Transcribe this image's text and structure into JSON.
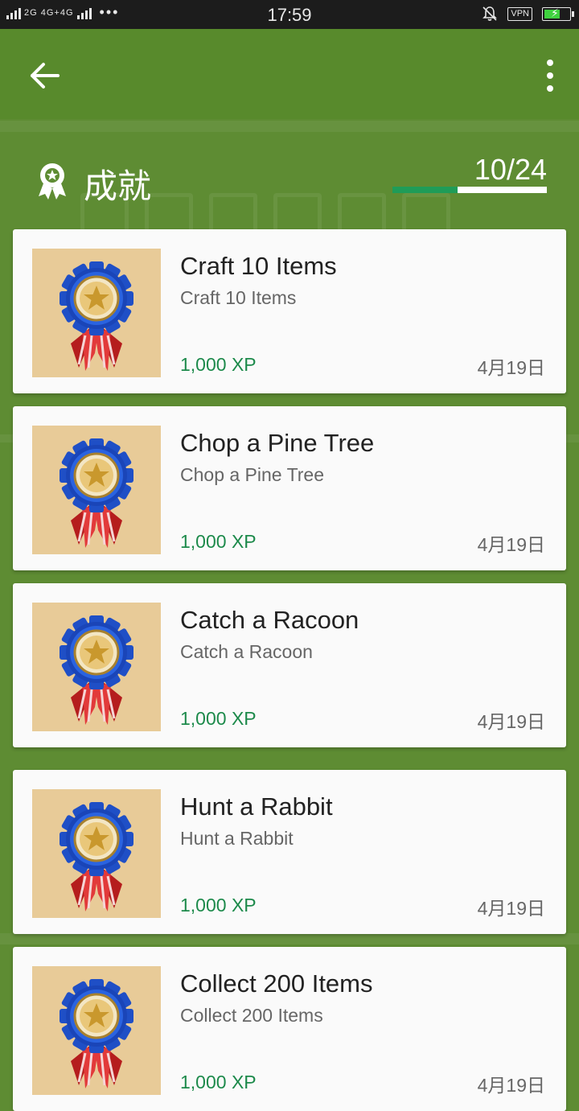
{
  "status_bar": {
    "signal_text": "2G 4G+4G",
    "time": "17:59",
    "vpn_label": "VPN",
    "battery_level": 0.65
  },
  "app_bar": {
    "back_icon": "arrow-left-icon",
    "menu_icon": "more-vertical-icon"
  },
  "header": {
    "title": "成就",
    "icon": "medal-icon",
    "counter": "10/24",
    "progress": 0.42,
    "progress_color": "#1f9c58"
  },
  "achievements": [
    {
      "title": "Craft 10 Items",
      "description": "Craft 10 Items",
      "xp": "1,000 XP",
      "date": "4月19日"
    },
    {
      "title": "Chop a Pine Tree",
      "description": "Chop a Pine Tree",
      "xp": "1,000 XP",
      "date": "4月19日"
    },
    {
      "title": "Catch a Racoon",
      "description": "Catch a Racoon",
      "xp": "1,000 XP",
      "date": "4月19日"
    },
    {
      "title": "Hunt a Rabbit",
      "description": "Hunt a Rabbit",
      "xp": "1,000 XP",
      "date": "4月19日"
    },
    {
      "title": "Collect 200 Items",
      "description": "Collect 200 Items",
      "xp": "1,000 XP",
      "date": "4月19日"
    }
  ],
  "colors": {
    "background": "#5e8c33",
    "xp_text": "#1d8a4b",
    "badge_background": "#e8cb98"
  }
}
